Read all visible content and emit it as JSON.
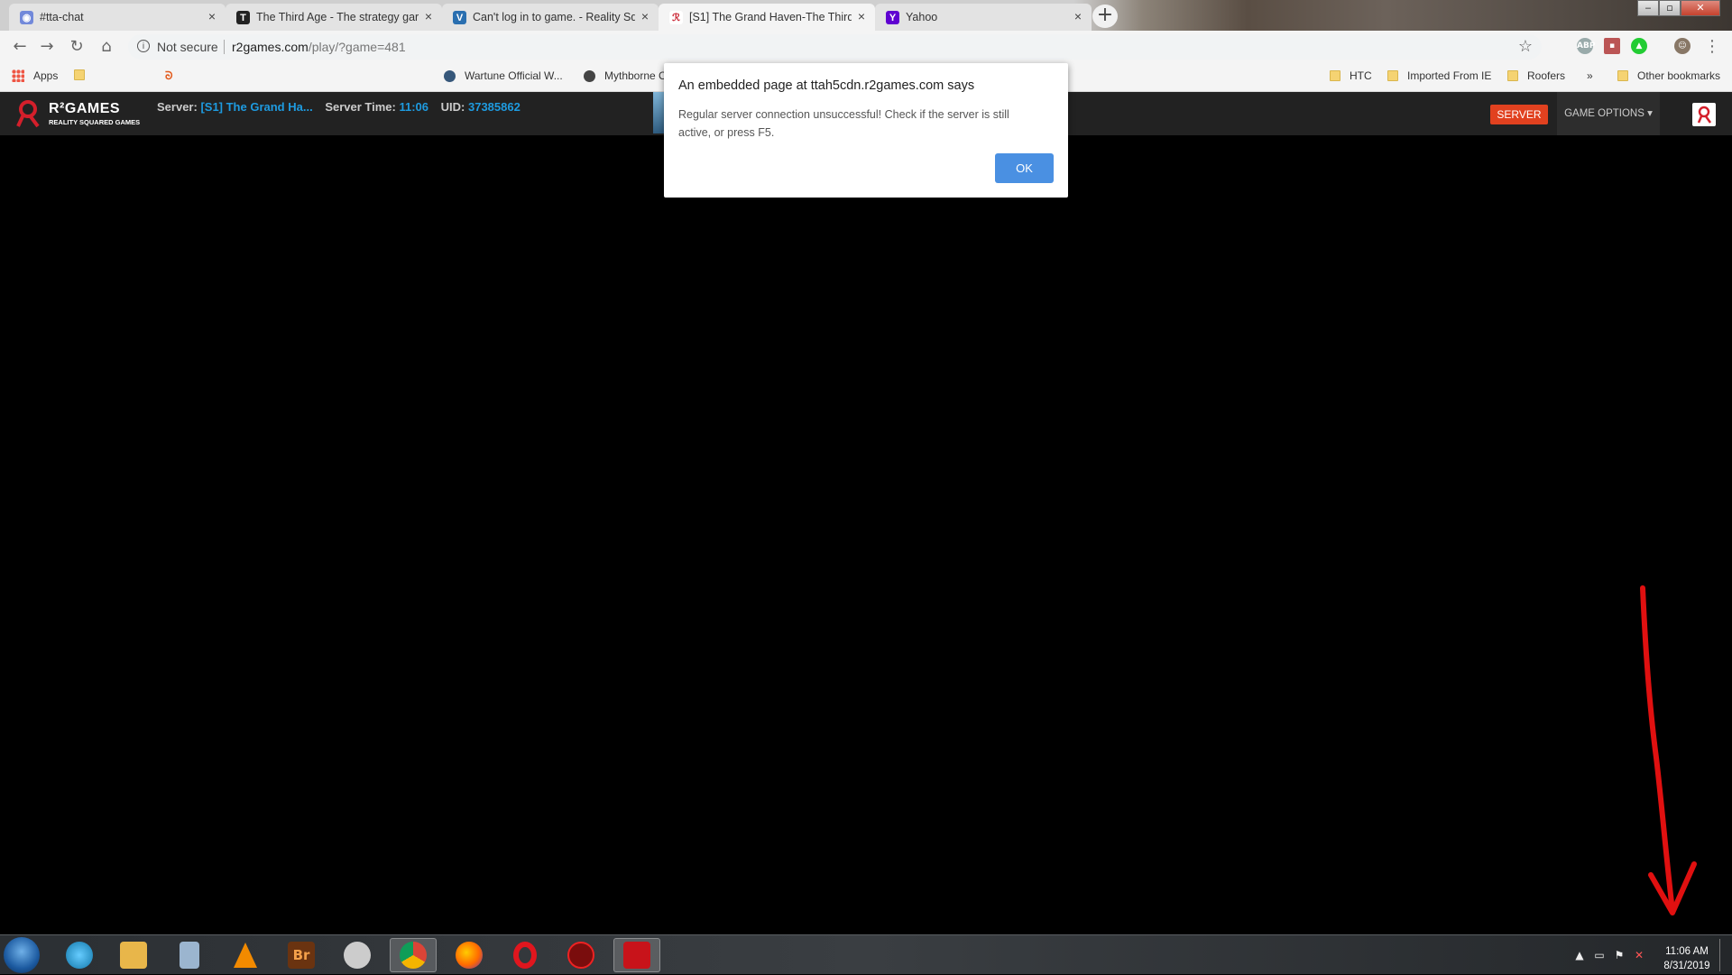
{
  "tabs": [
    {
      "title": "#tta-chat",
      "favicon": "discord-icon",
      "color": "#7289da"
    },
    {
      "title": "The Third Age - The strategy gar",
      "favicon": "third-age-icon",
      "color": "#222222"
    },
    {
      "title": "Can't log in to game. - Reality Sq",
      "favicon": "reality-squared-icon",
      "color": "#2a6fb0"
    },
    {
      "title": "[S1] The Grand Haven-The Third",
      "favicon": "r2games-icon",
      "color": "#c8202e",
      "active": true
    },
    {
      "title": "Yahoo",
      "favicon": "yahoo-icon",
      "color": "#5f01d1"
    }
  ],
  "address": {
    "security_label": "Not secure",
    "url_host": "r2games.com",
    "url_rest": "/play/?game=481"
  },
  "bookmarks": {
    "apps": "Apps",
    "wartune": "Wartune Official W...",
    "mythborne": "Mythborne C",
    "htc": "HTC",
    "imported": "Imported From IE",
    "roofers": "Roofers",
    "more": "»",
    "other": "Other bookmarks"
  },
  "site": {
    "brand": "R²GAMES",
    "brand_sub": "REALITY SQUARED GAMES",
    "server_label": "Server:",
    "server_value": "[S1] The Grand Ha...",
    "time_label": "Server Time:",
    "time_value": "11:06",
    "uid_label": "UID:",
    "uid_value": "37385862",
    "server_button": "SERVER",
    "game_options": "GAME OPTIONS ▾"
  },
  "dialog": {
    "title": "An embedded page at ttah5cdn.r2games.com says",
    "message": "Regular server connection unsuccessful! Check if the server is still active, or press F5.",
    "ok_label": "OK"
  },
  "taskbar": {
    "time": "11:06 AM",
    "date": "8/31/2019"
  },
  "colors": {
    "accent_blue": "#1e9be0",
    "server_button": "#e1411f",
    "ok_button": "#4a90e2",
    "annotation": "#e01010"
  }
}
